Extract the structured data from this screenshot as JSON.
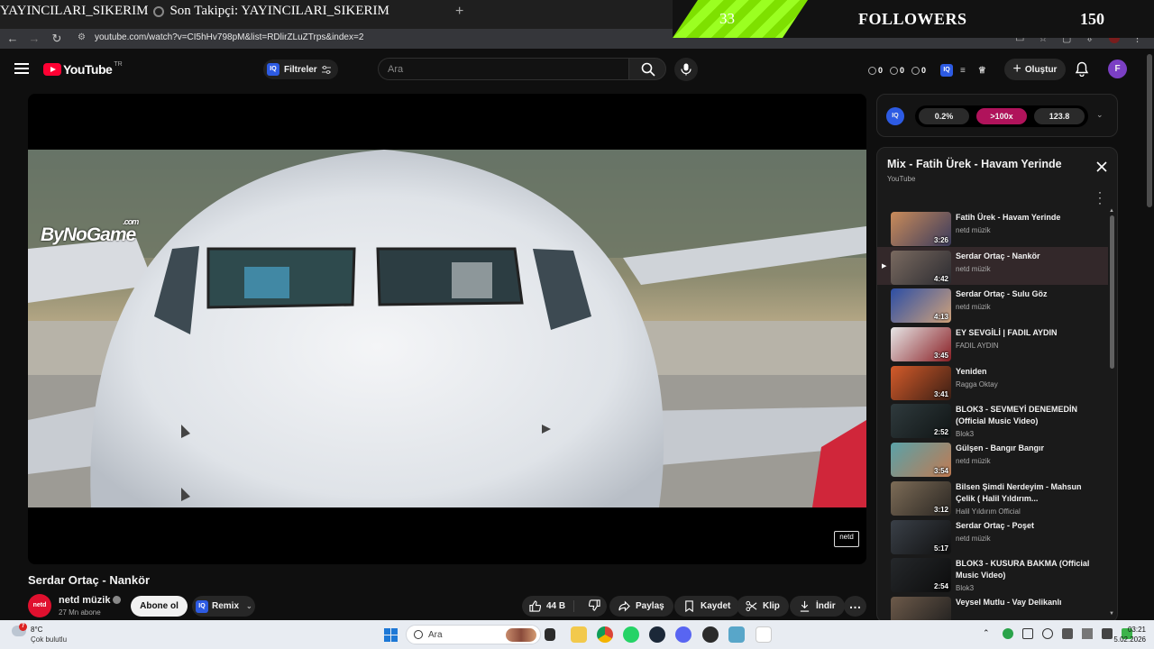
{
  "browser": {
    "ticker": {
      "a": "YAYINCILARI_SIKERIM",
      "b": "Son Takipçi: YAYINCILARI_SIKERIM"
    },
    "url": "youtube.com/watch?v=CI5hHv798pM&list=RDlirZLuZTrps&index=2"
  },
  "overlay": {
    "count": "33",
    "label": "FOLLOWERS",
    "goal": "150"
  },
  "header": {
    "logo_text": "YouTube",
    "region": "TR",
    "filters_label": "Filtreler",
    "search_placeholder": "Ara",
    "stats": [
      "0",
      "0",
      "0"
    ],
    "create_label": "Oluştur",
    "avatar_letter": "F",
    "iq_badge": "IQ"
  },
  "video": {
    "watermark": "ByNoGame",
    "watermark_sup": ".com",
    "corner_logo": "netd",
    "title": "Serdar Ortaç - Nankör",
    "channel": "netd müzik",
    "channel_avatar": "netd",
    "subscribers": "27 Mn abone",
    "subscribe_label": "Abone ol",
    "remix_label": "Remix",
    "likes": "44 B",
    "share_label": "Paylaş",
    "save_label": "Kaydet",
    "clip_label": "Klip",
    "download_label": "İndir"
  },
  "iq": {
    "badge": "IQ",
    "seg1": "0.2%",
    "seg2": ">100x",
    "seg3": "123.8"
  },
  "playlist": {
    "title": "Mix - Fatih Ürek - Havam Yerinde",
    "subtitle": "YouTube",
    "items": [
      {
        "title": "Fatih Ürek - Havam Yerinde",
        "channel": "netd müzik",
        "duration": "3:26",
        "c1": "#c98b5a",
        "c2": "#3b3b5c"
      },
      {
        "title": "Serdar Ortaç - Nankör",
        "channel": "netd müzik",
        "duration": "4:42",
        "c1": "#7a6a60",
        "c2": "#2b2b30"
      },
      {
        "title": "Serdar Ortaç - Sulu Göz",
        "channel": "netd müzik",
        "duration": "4:13",
        "c1": "#2c4ea5",
        "c2": "#d0a27a"
      },
      {
        "title": "EY SEVGİLİ | FADIL AYDIN",
        "channel": "FADIL AYDIN",
        "duration": "3:45",
        "c1": "#e6e6e6",
        "c2": "#8a1f25"
      },
      {
        "title": "Yeniden",
        "channel": "Ragga Oktay",
        "duration": "3:41",
        "c1": "#d45b2a",
        "c2": "#3a1e14"
      },
      {
        "title": "BLOK3 - SEVMEYİ DENEMEDİN (Official Music Video)",
        "channel": "Blok3",
        "duration": "2:52",
        "c1": "#2f3a3d",
        "c2": "#101515"
      },
      {
        "title": "Gülşen - Bangır Bangır",
        "channel": "netd müzik",
        "duration": "3:54",
        "c1": "#5aa2a8",
        "c2": "#c07a52"
      },
      {
        "title": "Bilsen Şimdi Nerdeyim - Mahsun Çelik ( Halil Yıldırım...",
        "channel": "Halil Yıldırım Official",
        "duration": "3:12",
        "c1": "#7d6c57",
        "c2": "#2a2622"
      },
      {
        "title": "Serdar Ortaç - Poşet",
        "channel": "netd müzik",
        "duration": "5:17",
        "c1": "#3a4048",
        "c2": "#101010"
      },
      {
        "title": "BLOK3 - KUSURA BAKMA (Official Music Video)",
        "channel": "Blok3",
        "duration": "2:54",
        "c1": "#25282b",
        "c2": "#0c0c0c"
      },
      {
        "title": "Veysel Mutlu - Vay Delikanlı",
        "channel": "",
        "duration": "",
        "c1": "#6d5a4a",
        "c2": "#1d1d1d"
      }
    ]
  },
  "taskbar": {
    "temp": "8°C",
    "weather": "Çok bulutlu",
    "weather_badge": "7",
    "search_label": "Ara",
    "time": "03:21",
    "date": "5.02.2026"
  }
}
